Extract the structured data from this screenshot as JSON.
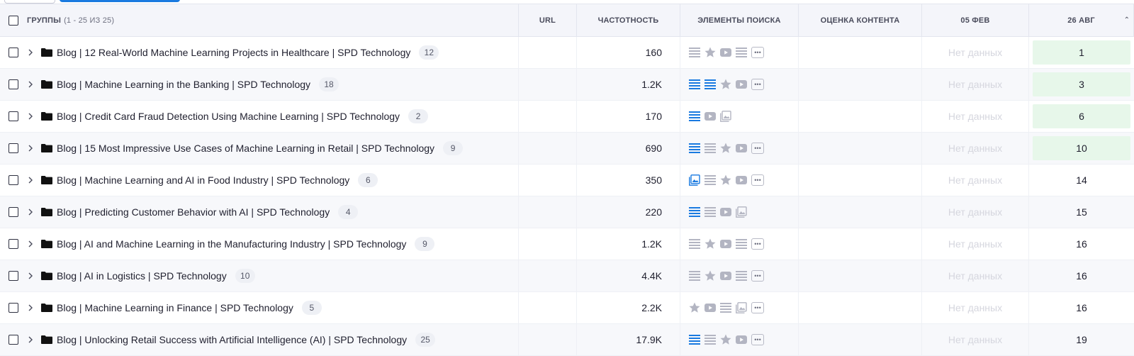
{
  "header": {
    "groups_label": "ГРУППЫ",
    "groups_range": "(1 - 25 ИЗ 25)",
    "url": "URL",
    "frequency": "ЧАСТОТНОСТЬ",
    "search_elements": "ЭЛЕМЕНТЫ ПОИСКА",
    "content_score": "ОЦЕНКА КОНТЕНТА",
    "date_feb": "05 ФЕВ",
    "date_aug": "26 АВГ"
  },
  "colors": {
    "accent_blue": "#1a7ae0",
    "icon_gray": "#b3b5c2",
    "green_bg": "#e7f7ea",
    "no_data": "#d5d6de"
  },
  "rows": [
    {
      "title": "Blog | 12 Real-World Machine Learning Projects in Healthcare | SPD Technology",
      "count": "12",
      "freq": "160",
      "feb": "Нет данных",
      "aug": "1",
      "highlight": true,
      "icons": [
        {
          "type": "list",
          "active": false
        },
        {
          "type": "star",
          "active": false
        },
        {
          "type": "video",
          "active": false
        },
        {
          "type": "list",
          "active": false
        },
        {
          "type": "more",
          "active": false
        }
      ]
    },
    {
      "title": "Blog | Machine Learning in the Banking | SPD Technology",
      "count": "18",
      "freq": "1.2K",
      "feb": "Нет данных",
      "aug": "3",
      "highlight": true,
      "icons": [
        {
          "type": "list",
          "active": true
        },
        {
          "type": "list",
          "active": true
        },
        {
          "type": "star",
          "active": false
        },
        {
          "type": "video",
          "active": false
        },
        {
          "type": "more",
          "active": false
        }
      ]
    },
    {
      "title": "Blog | Credit Card Fraud Detection Using Machine Learning | SPD Technology",
      "count": "2",
      "freq": "170",
      "feb": "Нет данных",
      "aug": "6",
      "highlight": true,
      "icons": [
        {
          "type": "list",
          "active": true
        },
        {
          "type": "video",
          "active": false
        },
        {
          "type": "image",
          "active": false
        }
      ]
    },
    {
      "title": "Blog | 15 Most Impressive Use Cases of Machine Learning in Retail | SPD Technology",
      "count": "9",
      "freq": "690",
      "feb": "Нет данных",
      "aug": "10",
      "highlight": true,
      "icons": [
        {
          "type": "list",
          "active": true
        },
        {
          "type": "list",
          "active": false
        },
        {
          "type": "star",
          "active": false
        },
        {
          "type": "video",
          "active": false
        },
        {
          "type": "more",
          "active": false
        }
      ]
    },
    {
      "title": "Blog | Machine Learning and AI in Food Industry | SPD Technology",
      "count": "6",
      "freq": "350",
      "feb": "Нет данных",
      "aug": "14",
      "highlight": false,
      "icons": [
        {
          "type": "image",
          "active": true
        },
        {
          "type": "list",
          "active": false
        },
        {
          "type": "star",
          "active": false
        },
        {
          "type": "video",
          "active": false
        },
        {
          "type": "more",
          "active": false
        }
      ]
    },
    {
      "title": "Blog | Predicting Customer Behavior with AI | SPD Technology",
      "count": "4",
      "freq": "220",
      "feb": "Нет данных",
      "aug": "15",
      "highlight": false,
      "icons": [
        {
          "type": "list",
          "active": true
        },
        {
          "type": "list",
          "active": false
        },
        {
          "type": "video",
          "active": false
        },
        {
          "type": "image",
          "active": false
        }
      ]
    },
    {
      "title": "Blog | AI and Machine Learning in the Manufacturing Industry | SPD Technology",
      "count": "9",
      "freq": "1.2K",
      "feb": "Нет данных",
      "aug": "16",
      "highlight": false,
      "icons": [
        {
          "type": "list",
          "active": false
        },
        {
          "type": "star",
          "active": false
        },
        {
          "type": "video",
          "active": false
        },
        {
          "type": "list",
          "active": false
        },
        {
          "type": "more",
          "active": false
        }
      ]
    },
    {
      "title": "Blog | AI in Logistics | SPD Technology",
      "count": "10",
      "freq": "4.4K",
      "feb": "Нет данных",
      "aug": "16",
      "highlight": false,
      "icons": [
        {
          "type": "list",
          "active": false
        },
        {
          "type": "star",
          "active": false
        },
        {
          "type": "video",
          "active": false
        },
        {
          "type": "list",
          "active": false
        },
        {
          "type": "more",
          "active": false
        }
      ]
    },
    {
      "title": "Blog | Machine Learning in Finance | SPD Technology",
      "count": "5",
      "freq": "2.2K",
      "feb": "Нет данных",
      "aug": "16",
      "highlight": false,
      "icons": [
        {
          "type": "star",
          "active": false
        },
        {
          "type": "video",
          "active": false
        },
        {
          "type": "list",
          "active": false
        },
        {
          "type": "image",
          "active": false
        },
        {
          "type": "more",
          "active": false
        }
      ]
    },
    {
      "title": "Blog | Unlocking Retail Success with Artificial Intelligence (AI) | SPD Technology",
      "count": "25",
      "freq": "17.9K",
      "feb": "Нет данных",
      "aug": "19",
      "highlight": false,
      "icons": [
        {
          "type": "list",
          "active": true
        },
        {
          "type": "list",
          "active": false
        },
        {
          "type": "star",
          "active": false
        },
        {
          "type": "video",
          "active": false
        },
        {
          "type": "more",
          "active": false
        }
      ]
    }
  ]
}
